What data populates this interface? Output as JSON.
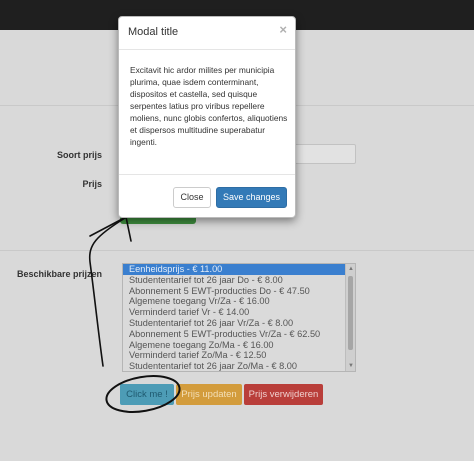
{
  "form": {
    "soort_prijs_label": "Soort prijs",
    "prijs_label": "Prijs",
    "beschikbare_prijzen_label": "Beschikbare prijzen",
    "prices": [
      "Eenheidsprijs - € 11.00",
      "Studententarief tot 26 jaar Do - € 8.00",
      "Abonnement 5 EWT-producties Do - € 47.50",
      "Algemene toegang Vr/Za - € 16.00",
      "Verminderd tarief Vr - € 14.00",
      "Studententarief tot 26 jaar Vr/Za - € 8.00",
      "Abonnement 5 EWT-producties Vr/Za - € 62.50",
      "Algemene toegang Zo/Ma - € 16.00",
      "Verminderd tarief Zo/Ma - € 12.50",
      "Studententarief tot 26 jaar Zo/Ma - € 8.00"
    ],
    "click_button": "Click me !",
    "update_button": "Prijs updaten",
    "delete_button": "Prijs verwijderen"
  },
  "modal": {
    "title": "Modal title",
    "close_glyph": "×",
    "body": "Excitavit hic ardor milites per municipia plurima, quae isdem conterminant, dispositos et castella, sed quisque serpentes latius pro viribus repellere moliens, nunc globis confertos, aliquotiens et dispersos multitudine superabatur ingenti.",
    "close_button": "Close",
    "save_button": "Save changes"
  },
  "colors": {
    "primary": "#337ab7",
    "info": "#5bc0de",
    "warning": "#f0ad4e",
    "danger": "#d9534f",
    "success": "#5cb85c"
  }
}
